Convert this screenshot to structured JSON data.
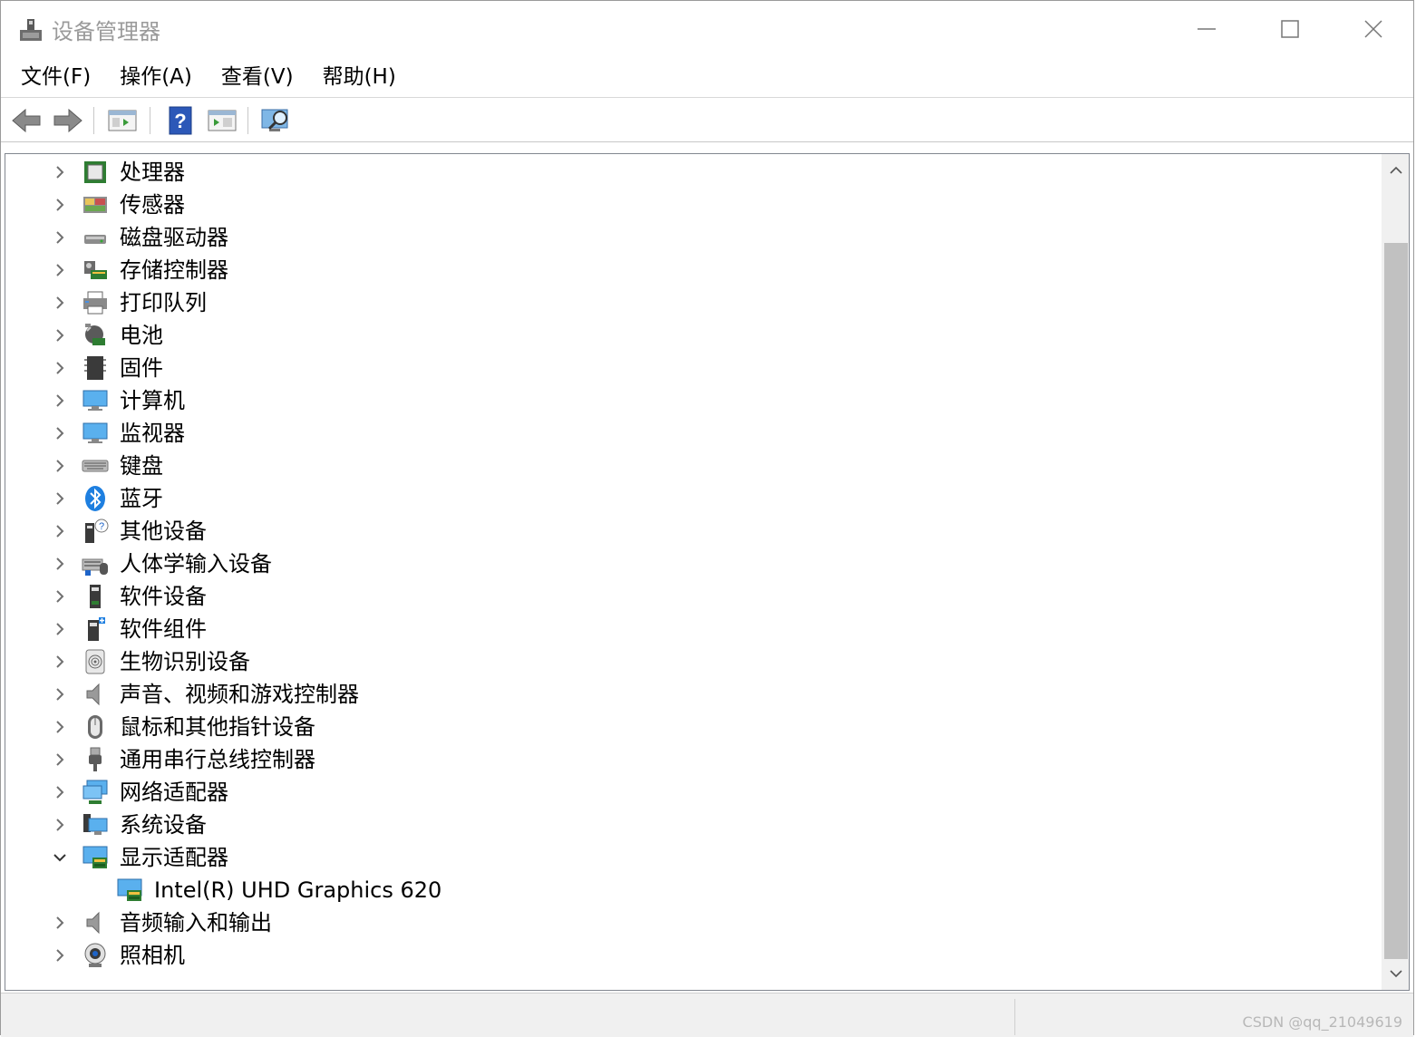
{
  "window": {
    "title": "设备管理器"
  },
  "menu": [
    {
      "label": "文件(F)"
    },
    {
      "label": "操作(A)"
    },
    {
      "label": "查看(V)"
    },
    {
      "label": "帮助(H)"
    }
  ],
  "toolbar": {
    "buttons": [
      "back-icon",
      "forward-icon",
      "properties-icon",
      "help-icon",
      "update-driver-icon",
      "scan-hardware-icon"
    ]
  },
  "tree": [
    {
      "label": "处理器",
      "icon": "processor-icon",
      "expanded": false
    },
    {
      "label": "传感器",
      "icon": "sensor-icon",
      "expanded": false
    },
    {
      "label": "磁盘驱动器",
      "icon": "disk-drive-icon",
      "expanded": false
    },
    {
      "label": "存储控制器",
      "icon": "storage-controller-icon",
      "expanded": false
    },
    {
      "label": "打印队列",
      "icon": "printer-icon",
      "expanded": false
    },
    {
      "label": "电池",
      "icon": "battery-icon",
      "expanded": false
    },
    {
      "label": "固件",
      "icon": "firmware-icon",
      "expanded": false
    },
    {
      "label": "计算机",
      "icon": "computer-icon",
      "expanded": false
    },
    {
      "label": "监视器",
      "icon": "monitor-icon",
      "expanded": false
    },
    {
      "label": "键盘",
      "icon": "keyboard-icon",
      "expanded": false
    },
    {
      "label": "蓝牙",
      "icon": "bluetooth-icon",
      "expanded": false
    },
    {
      "label": "其他设备",
      "icon": "other-devices-icon",
      "expanded": false
    },
    {
      "label": "人体学输入设备",
      "icon": "hid-icon",
      "expanded": false
    },
    {
      "label": "软件设备",
      "icon": "software-device-icon",
      "expanded": false
    },
    {
      "label": "软件组件",
      "icon": "software-component-icon",
      "expanded": false
    },
    {
      "label": "生物识别设备",
      "icon": "biometric-icon",
      "expanded": false
    },
    {
      "label": "声音、视频和游戏控制器",
      "icon": "sound-icon",
      "expanded": false
    },
    {
      "label": "鼠标和其他指针设备",
      "icon": "mouse-icon",
      "expanded": false
    },
    {
      "label": "通用串行总线控制器",
      "icon": "usb-icon",
      "expanded": false
    },
    {
      "label": "网络适配器",
      "icon": "network-adapter-icon",
      "expanded": false
    },
    {
      "label": "系统设备",
      "icon": "system-device-icon",
      "expanded": false
    },
    {
      "label": "显示适配器",
      "icon": "display-adapter-icon",
      "expanded": true,
      "children": [
        {
          "label": "Intel(R) UHD Graphics 620",
          "icon": "display-adapter-icon"
        }
      ]
    },
    {
      "label": "音频输入和输出",
      "icon": "audio-io-icon",
      "expanded": false
    },
    {
      "label": "照相机",
      "icon": "camera-icon",
      "expanded": false
    }
  ],
  "status": {
    "watermark": "CSDN @qq_21049619"
  }
}
